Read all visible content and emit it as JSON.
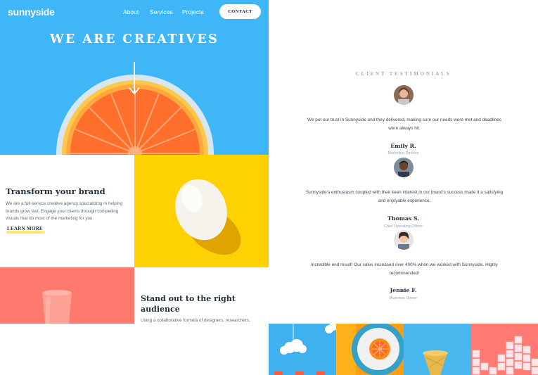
{
  "header": {
    "logo": "sunnyside",
    "nav": [
      "About",
      "Services",
      "Projects"
    ],
    "contact_label": "CONTACT"
  },
  "hero": {
    "title": "WE ARE CREATIVES"
  },
  "transform": {
    "title": "Transform your brand",
    "text": "We are a full-service creative agency specializing in helping brands grow fast. Engage your clients through compelling visuals that do most of the marketing for you.",
    "link_label": "LEARN MORE"
  },
  "standout": {
    "title": "Stand out to the right audience",
    "text": "Using a collaborative formula of designers, researchers,"
  },
  "testimonials": {
    "heading": "CLIENT TESTIMONIALS",
    "items": [
      {
        "quote": "We put our trust in Sunnyside and they delivered, making sure our needs were met and deadlines were always hit.",
        "name": "Emily R.",
        "role": "Marketing Director"
      },
      {
        "quote": "Sunnyside's enthusiasm coupled with their keen interest in our brand's success made it a satisfying and enjoyable experience.",
        "name": "Thomas S.",
        "role": "Chief Operating Officer"
      },
      {
        "quote": "Incredible end result! Our sales increased over 400% when we worked with Sunnyside. Highly recommended!",
        "name": "Jennie F.",
        "role": "Business Owner"
      }
    ]
  },
  "colors": {
    "hero_blue": "#3fb6f7",
    "egg_yellow": "#fed102",
    "cup_coral": "#fe7a6e",
    "dark_text": "#23303e"
  },
  "icons": [
    "arrow-down-icon"
  ]
}
